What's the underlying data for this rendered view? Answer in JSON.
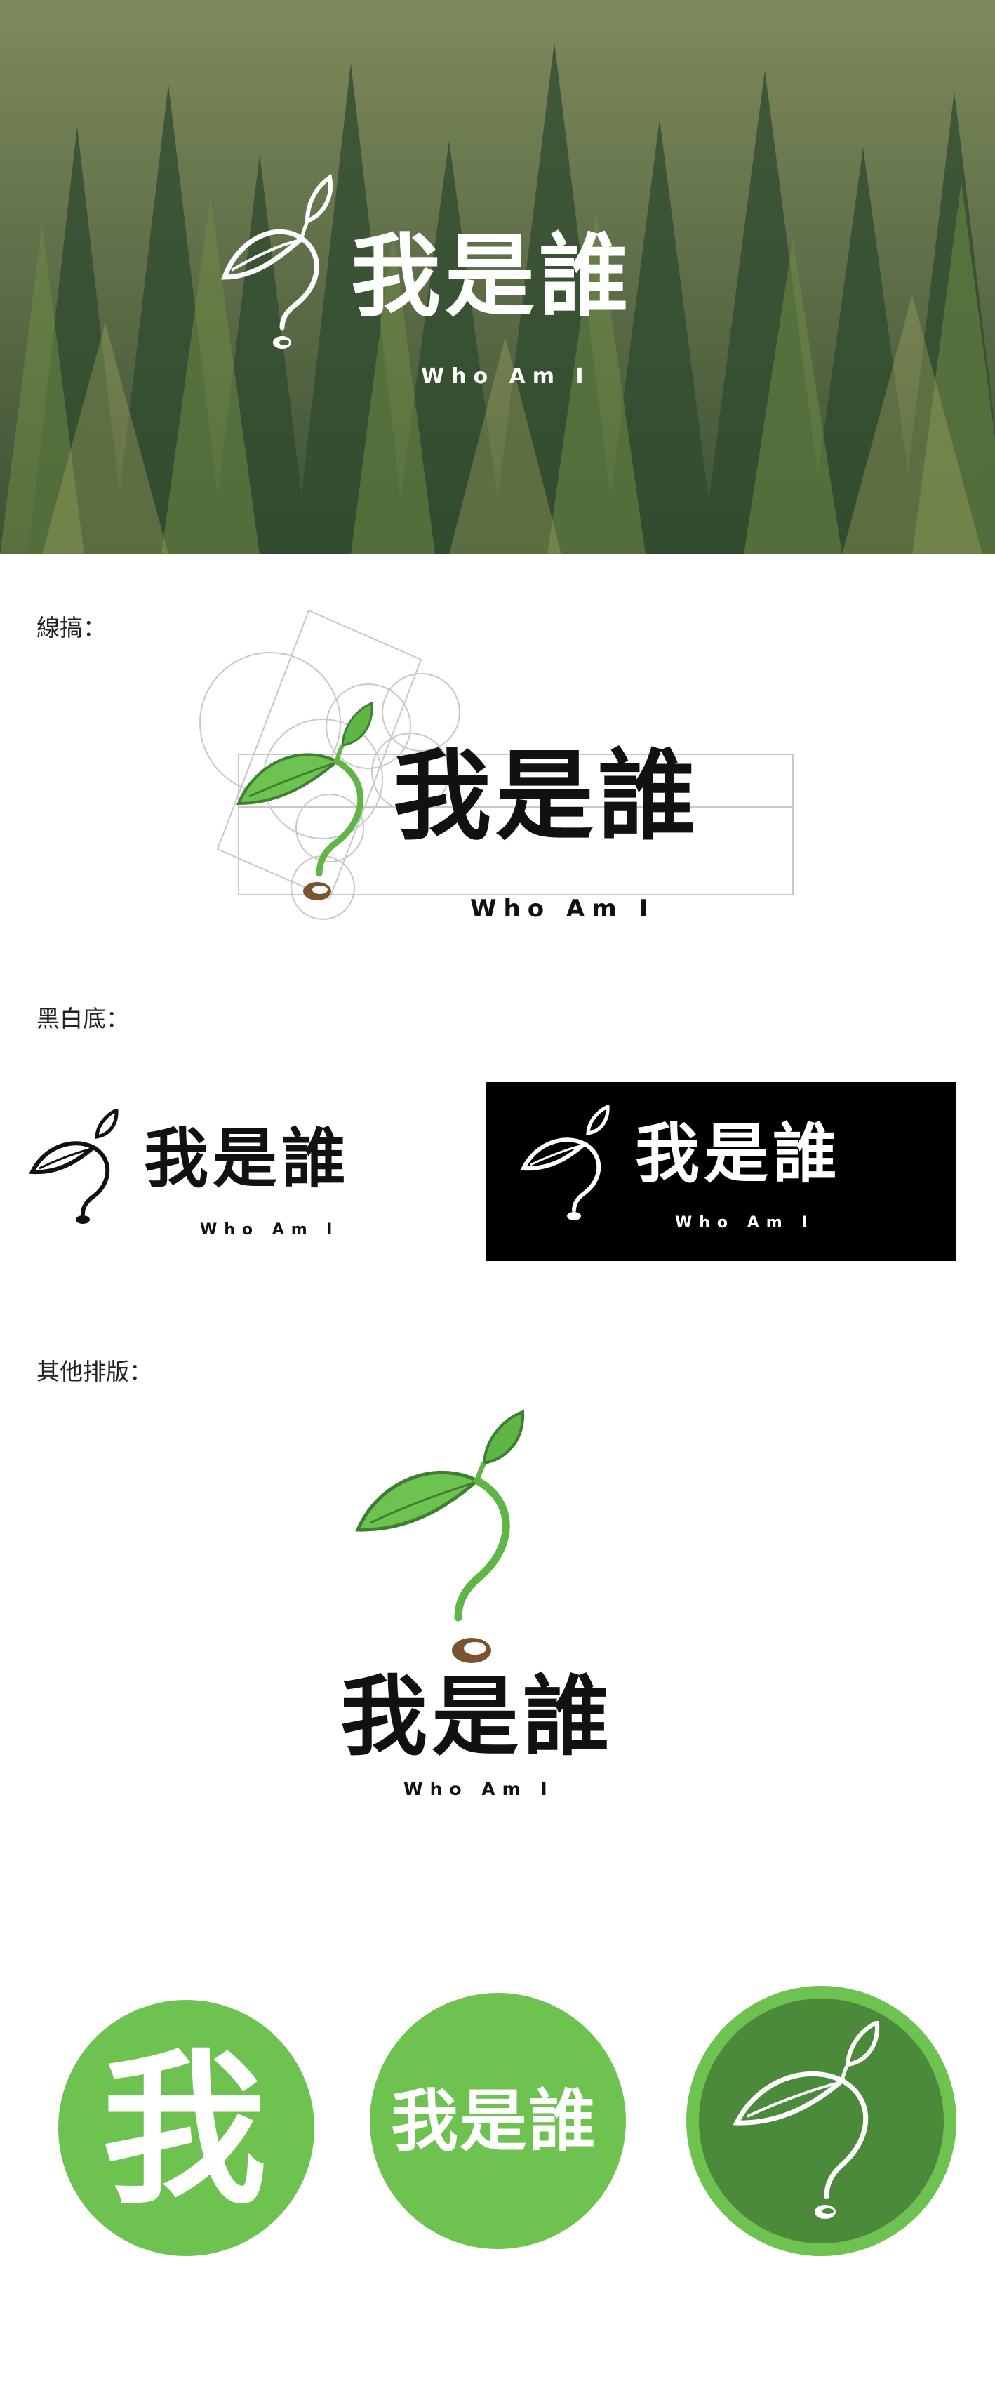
{
  "hero": {
    "title": "我是誰",
    "subtitle": "Who Am I"
  },
  "sections": {
    "sketch": "線搞：",
    "bw": "黑白底：",
    "other": "其他排版："
  },
  "logo": {
    "title": "我是誰",
    "subtitle": "Who Am I"
  },
  "circles": {
    "first_char": "我",
    "full_title": "我是誰"
  },
  "colors": {
    "leaf_green": "#5fb546",
    "light_green": "#6ec24f",
    "dark_green": "#4a8a3a",
    "seed_brown": "#7a5330",
    "text_black": "#111111"
  }
}
